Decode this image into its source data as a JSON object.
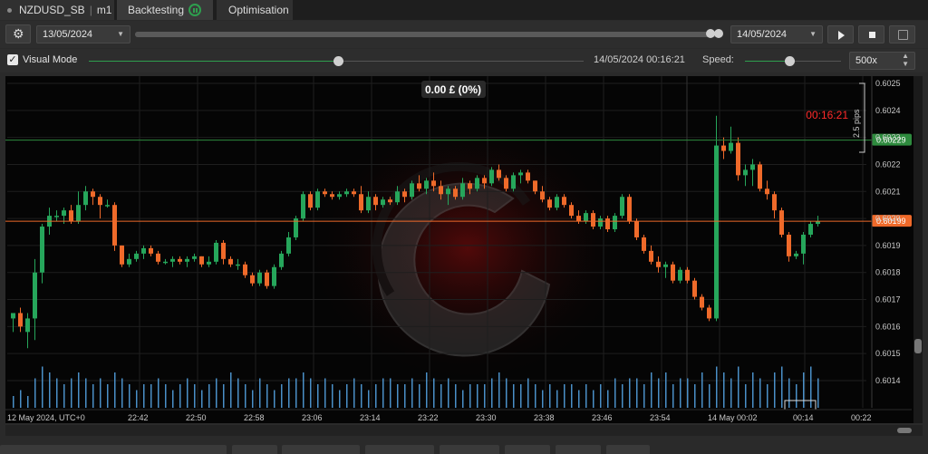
{
  "tabs": {
    "symbol": "NZDUSD_SB",
    "timeframe": "m1",
    "backtesting": "Backtesting",
    "optimisation": "Optimisation"
  },
  "toolbar": {
    "start_date": "13/05/2024",
    "end_date": "14/05/2024",
    "visual_mode_label": "Visual Mode",
    "visual_mode_checked": true,
    "current_time": "14/05/2024 00:16:21",
    "speed_label": "Speed:",
    "speed_value": "500x"
  },
  "chart": {
    "pnl": "0.00 £ (0%)",
    "countdown": "00:16:21",
    "pips_label": "2.5 pips",
    "price_upper": "0.60229",
    "price_lower": "0.60199",
    "y_ticks": [
      "0.6025",
      "0.6024",
      "0.6023",
      "0.6022",
      "0.6021",
      "0.6020",
      "0.6019",
      "0.6018",
      "0.6017",
      "0.6016",
      "0.6015",
      "0.6014"
    ],
    "x_ticks": [
      "12 May 2024, UTC+0",
      "22:42",
      "22:50",
      "22:58",
      "23:06",
      "23:14",
      "23:22",
      "23:30",
      "23:38",
      "23:46",
      "23:54",
      "14 May 00:02",
      "00:14",
      "00:22"
    ],
    "colors": {
      "bull": "#26a65b",
      "bear": "#ef6a2a",
      "volume": "#4a90c8",
      "ask_line": "#2e8b3e",
      "bid_line": "#ef6a2a",
      "countdown": "#ff2a2a"
    }
  },
  "chart_data": {
    "type": "candlestick",
    "symbol": "NZDUSD_SB",
    "timeframe": "m1",
    "ylim": [
      0.60135,
      0.60255
    ],
    "candles": [
      [
        0.60163,
        0.60165,
        0.60158,
        0.60165
      ],
      [
        0.60165,
        0.60167,
        0.60158,
        0.6016
      ],
      [
        0.60158,
        0.60165,
        0.60152,
        0.60163
      ],
      [
        0.60163,
        0.60185,
        0.60155,
        0.6018
      ],
      [
        0.6018,
        0.60198,
        0.60176,
        0.60197
      ],
      [
        0.60197,
        0.60204,
        0.60194,
        0.60201
      ],
      [
        0.60201,
        0.60203,
        0.60199,
        0.60201
      ],
      [
        0.60201,
        0.60204,
        0.60198,
        0.60203
      ],
      [
        0.60203,
        0.60205,
        0.60198,
        0.60199
      ],
      [
        0.60199,
        0.6021,
        0.60198,
        0.60205
      ],
      [
        0.60205,
        0.60212,
        0.60203,
        0.6021
      ],
      [
        0.6021,
        0.60211,
        0.60205,
        0.60208
      ],
      [
        0.60208,
        0.60209,
        0.602,
        0.60205
      ],
      [
        0.60205,
        0.60207,
        0.60204,
        0.60205
      ],
      [
        0.60205,
        0.60206,
        0.60188,
        0.6019
      ],
      [
        0.6019,
        0.6019,
        0.60182,
        0.60183
      ],
      [
        0.60183,
        0.60187,
        0.60182,
        0.60185
      ],
      [
        0.60185,
        0.60188,
        0.60184,
        0.60187
      ],
      [
        0.60187,
        0.6019,
        0.60185,
        0.60189
      ],
      [
        0.60189,
        0.6019,
        0.60186,
        0.60187
      ],
      [
        0.60187,
        0.60188,
        0.60183,
        0.60184
      ],
      [
        0.60184,
        0.60185,
        0.60183,
        0.60184
      ],
      [
        0.60184,
        0.60186,
        0.60182,
        0.60185
      ],
      [
        0.60185,
        0.60186,
        0.60183,
        0.60184
      ],
      [
        0.60184,
        0.60186,
        0.60182,
        0.60185
      ],
      [
        0.60185,
        0.60187,
        0.60184,
        0.60186
      ],
      [
        0.60186,
        0.60186,
        0.60182,
        0.60183
      ],
      [
        0.60183,
        0.60186,
        0.60182,
        0.60184
      ],
      [
        0.60184,
        0.60192,
        0.60183,
        0.60191
      ],
      [
        0.60191,
        0.60192,
        0.60183,
        0.60185
      ],
      [
        0.60185,
        0.60186,
        0.60182,
        0.60183
      ],
      [
        0.60183,
        0.60185,
        0.60181,
        0.60183
      ],
      [
        0.60183,
        0.60184,
        0.60178,
        0.60179
      ],
      [
        0.60179,
        0.6018,
        0.60175,
        0.60176
      ],
      [
        0.60176,
        0.60181,
        0.60175,
        0.6018
      ],
      [
        0.6018,
        0.60181,
        0.60174,
        0.60175
      ],
      [
        0.60175,
        0.60183,
        0.60174,
        0.60182
      ],
      [
        0.60182,
        0.60188,
        0.60181,
        0.60187
      ],
      [
        0.60187,
        0.60195,
        0.60186,
        0.60193
      ],
      [
        0.60193,
        0.60201,
        0.60192,
        0.602
      ],
      [
        0.602,
        0.6021,
        0.60199,
        0.60209
      ],
      [
        0.60209,
        0.6021,
        0.60203,
        0.60204
      ],
      [
        0.60204,
        0.60211,
        0.60203,
        0.6021
      ],
      [
        0.6021,
        0.60211,
        0.60208,
        0.60209
      ],
      [
        0.60209,
        0.6021,
        0.60207,
        0.60208
      ],
      [
        0.60208,
        0.6021,
        0.60207,
        0.60209
      ],
      [
        0.60209,
        0.60211,
        0.60208,
        0.6021
      ],
      [
        0.6021,
        0.60211,
        0.60208,
        0.60209
      ],
      [
        0.60209,
        0.60212,
        0.60202,
        0.60203
      ],
      [
        0.60203,
        0.6021,
        0.60202,
        0.60208
      ],
      [
        0.60208,
        0.60209,
        0.60203,
        0.60205
      ],
      [
        0.60205,
        0.60208,
        0.60204,
        0.60207
      ],
      [
        0.60207,
        0.60208,
        0.60205,
        0.60206
      ],
      [
        0.60206,
        0.60212,
        0.60205,
        0.6021
      ],
      [
        0.6021,
        0.60211,
        0.60206,
        0.60208
      ],
      [
        0.60208,
        0.60214,
        0.60207,
        0.60213
      ],
      [
        0.60213,
        0.60216,
        0.6021,
        0.60211
      ],
      [
        0.60211,
        0.60215,
        0.60209,
        0.60214
      ],
      [
        0.60214,
        0.60217,
        0.6021,
        0.60212
      ],
      [
        0.60212,
        0.60214,
        0.60207,
        0.60209
      ],
      [
        0.60209,
        0.60212,
        0.60205,
        0.60211
      ],
      [
        0.60211,
        0.60212,
        0.60207,
        0.60208
      ],
      [
        0.60208,
        0.60215,
        0.60207,
        0.60213
      ],
      [
        0.60213,
        0.60214,
        0.60209,
        0.60211
      ],
      [
        0.60211,
        0.60216,
        0.6021,
        0.60215
      ],
      [
        0.60215,
        0.60216,
        0.60211,
        0.60213
      ],
      [
        0.60213,
        0.60219,
        0.60212,
        0.60218
      ],
      [
        0.60218,
        0.6022,
        0.60214,
        0.60215
      ],
      [
        0.60215,
        0.60216,
        0.6021,
        0.60211
      ],
      [
        0.60211,
        0.60217,
        0.6021,
        0.60216
      ],
      [
        0.60216,
        0.60218,
        0.60213,
        0.60217
      ],
      [
        0.60217,
        0.60218,
        0.60213,
        0.60214
      ],
      [
        0.60214,
        0.60214,
        0.60209,
        0.6021
      ],
      [
        0.6021,
        0.60212,
        0.60206,
        0.60207
      ],
      [
        0.60207,
        0.60208,
        0.60203,
        0.60204
      ],
      [
        0.60204,
        0.60209,
        0.60203,
        0.60208
      ],
      [
        0.60208,
        0.60209,
        0.60204,
        0.60205
      ],
      [
        0.60205,
        0.60206,
        0.602,
        0.60201
      ],
      [
        0.60201,
        0.60203,
        0.60198,
        0.60199
      ],
      [
        0.60199,
        0.60203,
        0.60198,
        0.60202
      ],
      [
        0.60202,
        0.60203,
        0.60196,
        0.60197
      ],
      [
        0.60197,
        0.60201,
        0.60196,
        0.602
      ],
      [
        0.602,
        0.60201,
        0.60195,
        0.60196
      ],
      [
        0.60196,
        0.60202,
        0.60195,
        0.60201
      ],
      [
        0.60201,
        0.60209,
        0.602,
        0.60208
      ],
      [
        0.60208,
        0.60209,
        0.60198,
        0.60199
      ],
      [
        0.60199,
        0.602,
        0.60192,
        0.60193
      ],
      [
        0.60193,
        0.60194,
        0.60187,
        0.60188
      ],
      [
        0.60188,
        0.6019,
        0.60183,
        0.60184
      ],
      [
        0.60184,
        0.60186,
        0.6018,
        0.60182
      ],
      [
        0.60182,
        0.60184,
        0.60178,
        0.60183
      ],
      [
        0.60183,
        0.60184,
        0.60176,
        0.60177
      ],
      [
        0.60177,
        0.60182,
        0.60176,
        0.60181
      ],
      [
        0.60181,
        0.60182,
        0.60176,
        0.60177
      ],
      [
        0.60177,
        0.60178,
        0.6017,
        0.60171
      ],
      [
        0.60171,
        0.60172,
        0.60166,
        0.60167
      ],
      [
        0.60167,
        0.60168,
        0.60162,
        0.60163
      ],
      [
        0.60163,
        0.60238,
        0.60162,
        0.60227
      ],
      [
        0.60227,
        0.6023,
        0.60222,
        0.60225
      ],
      [
        0.60225,
        0.60234,
        0.60224,
        0.60228
      ],
      [
        0.60228,
        0.6023,
        0.60214,
        0.60216
      ],
      [
        0.60216,
        0.6022,
        0.60212,
        0.60218
      ],
      [
        0.60218,
        0.60222,
        0.60212,
        0.6022
      ],
      [
        0.6022,
        0.60221,
        0.6021,
        0.60211
      ],
      [
        0.60211,
        0.60214,
        0.60207,
        0.60209
      ],
      [
        0.60209,
        0.6021,
        0.602,
        0.60203
      ],
      [
        0.60203,
        0.60204,
        0.60193,
        0.60194
      ],
      [
        0.60194,
        0.60195,
        0.60184,
        0.60186
      ],
      [
        0.60186,
        0.60188,
        0.60185,
        0.60187
      ],
      [
        0.60187,
        0.60195,
        0.60183,
        0.60194
      ],
      [
        0.60194,
        0.60199,
        0.60193,
        0.60198
      ],
      [
        0.60198,
        0.60201,
        0.60197,
        0.60199
      ]
    ],
    "volumes": [
      2,
      3,
      2,
      5,
      7,
      6,
      5,
      4,
      5,
      6,
      5,
      4,
      5,
      4,
      6,
      5,
      4,
      3,
      4,
      4,
      5,
      4,
      3,
      4,
      5,
      4,
      3,
      4,
      5,
      4,
      6,
      5,
      4,
      3,
      5,
      4,
      3,
      4,
      5,
      5,
      6,
      5,
      4,
      5,
      4,
      3,
      4,
      5,
      4,
      3,
      4,
      5,
      5,
      4,
      4,
      5,
      4,
      6,
      5,
      4,
      5,
      4,
      3,
      4,
      4,
      4,
      5,
      6,
      5,
      4,
      4,
      5,
      4,
      3,
      4,
      3,
      4,
      4,
      3,
      4,
      3,
      4,
      3,
      5,
      4,
      5,
      5,
      4,
      6,
      5,
      6,
      4,
      5,
      5,
      4,
      6,
      4,
      7,
      6,
      5,
      7,
      4,
      6,
      5,
      4,
      6,
      7,
      5,
      4,
      6,
      7,
      5,
      4,
      5,
      2
    ]
  }
}
